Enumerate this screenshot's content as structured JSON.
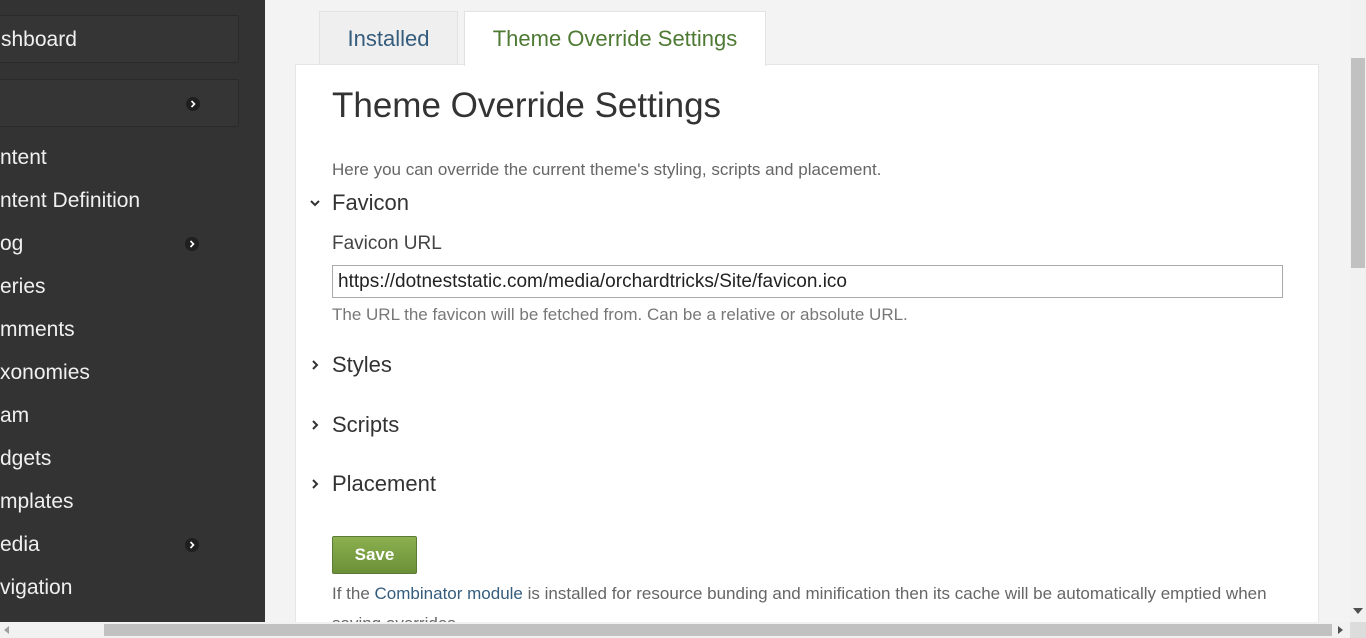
{
  "sidebar": {
    "dashboard_label": "shboard",
    "items": [
      {
        "label": "ntent"
      },
      {
        "label": "ntent Definition"
      },
      {
        "label": "og"
      },
      {
        "label": "eries"
      },
      {
        "label": "mments"
      },
      {
        "label": "xonomies"
      },
      {
        "label": "am"
      },
      {
        "label": "dgets"
      },
      {
        "label": "mplates"
      },
      {
        "label": "edia"
      },
      {
        "label": "vigation"
      }
    ]
  },
  "tabs": [
    {
      "label": "Installed"
    },
    {
      "label": "Theme Override Settings",
      "active": true
    }
  ],
  "page": {
    "title": "Theme Override Settings",
    "intro": "Here you can override the current theme's styling, scripts and placement."
  },
  "sections": {
    "favicon": {
      "title": "Favicon",
      "expanded": true
    },
    "styles": {
      "title": "Styles",
      "expanded": false
    },
    "scripts": {
      "title": "Scripts",
      "expanded": false
    },
    "placement": {
      "title": "Placement",
      "expanded": false
    }
  },
  "favicon_field": {
    "label": "Favicon URL",
    "value": "https://dotneststatic.com/media/orchardtricks/Site/favicon.ico",
    "hint": "The URL the favicon will be fetched from. Can be a relative or absolute URL."
  },
  "save_label": "Save",
  "note": {
    "before": "If the ",
    "link": "Combinator module",
    "after": " is installed for resource bunding and minification then its cache will be automatically emptied when saving overrides."
  },
  "colors": {
    "sidebar_bg": "#333333",
    "active_tab_text": "#4e7a34",
    "link": "#355c7d",
    "save_button": "#7aa045"
  }
}
